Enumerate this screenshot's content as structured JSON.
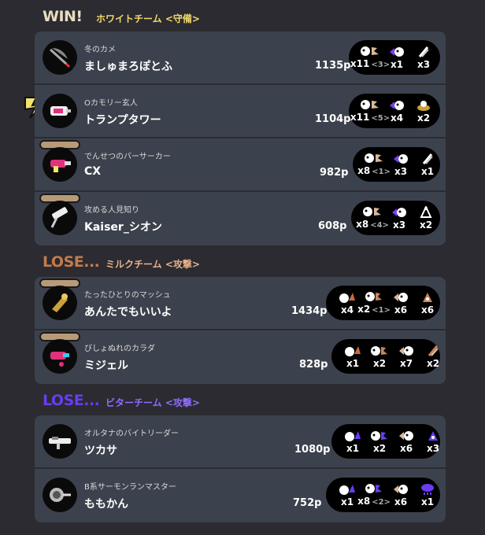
{
  "teams": [
    {
      "result": "WIN!",
      "team_name": "ホワイトチーム <守備>",
      "result_color": "#e8dcc0",
      "players": [
        {
          "title": "冬のカメ",
          "name": "ましゅまろぽとふ",
          "points": "1135p",
          "stats": [
            {
              "value": "x11",
              "sub": "<3>"
            },
            {
              "value": "x1",
              "sub": ""
            },
            {
              "value": "x3",
              "sub": ""
            }
          ]
        },
        {
          "title": "Oカモリー玄人",
          "name": "トランプタワー",
          "points": "1104p",
          "stats": [
            {
              "value": "x11",
              "sub": "<5>"
            },
            {
              "value": "x4",
              "sub": ""
            },
            {
              "value": "x2",
              "sub": ""
            }
          ]
        },
        {
          "title": "でんせつのバーサーカー",
          "name": "CX",
          "points": "982p",
          "stats": [
            {
              "value": "x8",
              "sub": "<1>"
            },
            {
              "value": "x3",
              "sub": ""
            },
            {
              "value": "x1",
              "sub": ""
            }
          ]
        },
        {
          "title": "攻める人見知り",
          "name": "Kaiser_シオン",
          "points": "608p",
          "stats": [
            {
              "value": "x8",
              "sub": "<4>"
            },
            {
              "value": "x3",
              "sub": ""
            },
            {
              "value": "x2",
              "sub": ""
            }
          ]
        }
      ]
    },
    {
      "result": "LOSE...",
      "team_name": "ミルクチーム <攻撃>",
      "result_color": "#c47a4a",
      "players": [
        {
          "title": "たったひとりのマッシュ",
          "name": "あんたでもいいよ",
          "points": "1434p",
          "stats": [
            {
              "value": "x4",
              "sub": ""
            },
            {
              "value": "x2",
              "sub": "<1>"
            },
            {
              "value": "x6",
              "sub": ""
            },
            {
              "value": "x6",
              "sub": ""
            }
          ]
        },
        {
          "title": "びしょぬれのカラダ",
          "name": "ミジェル",
          "points": "828p",
          "stats": [
            {
              "value": "x1",
              "sub": ""
            },
            {
              "value": "x2",
              "sub": ""
            },
            {
              "value": "x7",
              "sub": ""
            },
            {
              "value": "x2",
              "sub": ""
            }
          ]
        }
      ]
    },
    {
      "result": "LOSE...",
      "team_name": "ビターチーム <攻撃>",
      "result_color": "#6a3cf0",
      "players": [
        {
          "title": "オルタナのバイトリーダー",
          "name": "ツカサ",
          "points": "1080p",
          "stats": [
            {
              "value": "x1",
              "sub": ""
            },
            {
              "value": "x2",
              "sub": ""
            },
            {
              "value": "x6",
              "sub": ""
            },
            {
              "value": "x3",
              "sub": ""
            }
          ]
        },
        {
          "title": "B系サーモンランマスター",
          "name": "ももかん",
          "points": "752p",
          "stats": [
            {
              "value": "x1",
              "sub": ""
            },
            {
              "value": "x8",
              "sub": "<2>"
            },
            {
              "value": "x6",
              "sub": ""
            },
            {
              "value": "x1",
              "sub": ""
            }
          ]
        }
      ]
    }
  ],
  "colors": {
    "background": "#2b2b31",
    "panel": "#3c424d",
    "team_name": "#f2d96a",
    "lose_team_name_milk": "#e8b08a",
    "lose_team_name_bitter": "#8f6bff"
  }
}
